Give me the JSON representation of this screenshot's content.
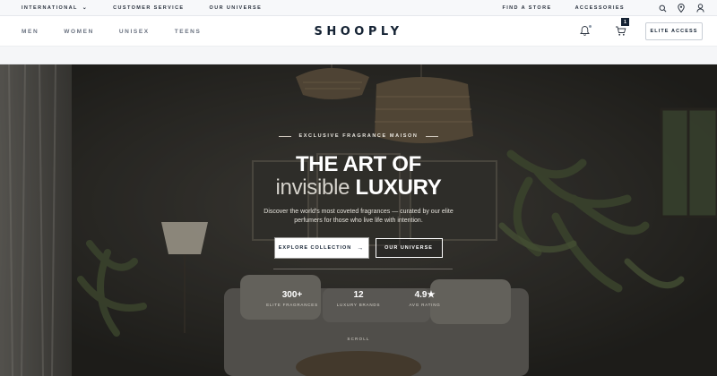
{
  "utility_bar": {
    "region_label": "INTERNATIONAL",
    "links": [
      "CUSTOMER SERVICE",
      "OUR UNIVERSE"
    ],
    "right_links": [
      "FIND A STORE",
      "ACCESSORIES"
    ],
    "icons": [
      "search-icon",
      "location-icon",
      "user-icon"
    ]
  },
  "nav": {
    "categories": [
      "MEN",
      "WOMEN",
      "UNISEX",
      "TEENS"
    ],
    "brand": "SHOOPLY",
    "cart_count": "1",
    "elite_button": "ELITE ACCESS"
  },
  "hero": {
    "eyebrow": "EXCLUSIVE FRAGRANCE MAISON",
    "title_line1": "THE ART OF",
    "title_line2_light": "invisible",
    "title_line2_bold": "LUXURY",
    "subtitle": "Discover the world's most coveted fragrances — curated by our elite perfumers for those who live life with intention.",
    "primary_cta": "EXPLORE COLLECTION",
    "secondary_cta": "OUR UNIVERSE",
    "stats": [
      {
        "value": "300+",
        "label": "ELITE FRAGRANCES"
      },
      {
        "value": "12",
        "label": "LUXURY BRANDS"
      },
      {
        "value": "4.9★",
        "label": "AVG RATING"
      }
    ],
    "scroll_label": "SCROLL"
  },
  "colors": {
    "brand_navy": "#142233",
    "hero_overlay": "#2b2a27",
    "utility_bg": "#f7f8fa"
  }
}
